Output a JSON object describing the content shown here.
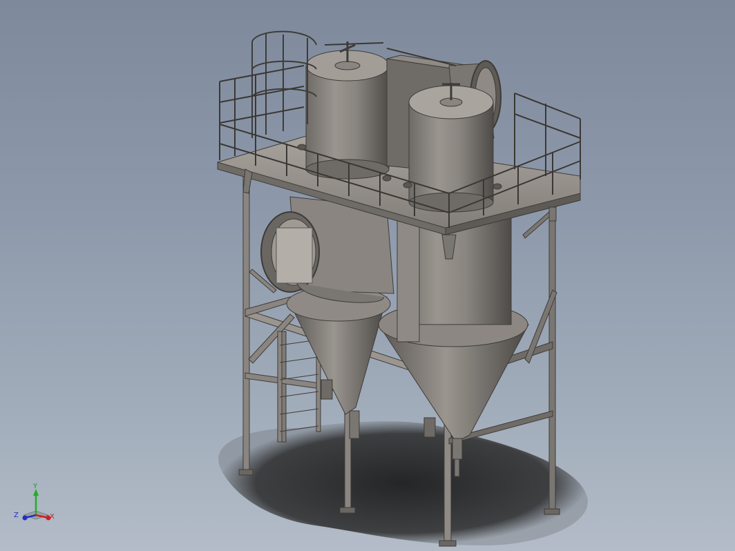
{
  "viewport": {
    "background_top": "#7e8a9c",
    "background_bottom": "#b3bcc8"
  },
  "model": {
    "steel_color": "#8a8580",
    "steel_dark": "#4a4744",
    "steel_light": "#b8b3ad",
    "shadow_color": "#2a2a2a"
  },
  "triad": {
    "x_label": "X",
    "y_label": "Y",
    "z_label": "Z",
    "x_color": "#d02020",
    "y_color": "#20b020",
    "z_color": "#2030c0"
  }
}
